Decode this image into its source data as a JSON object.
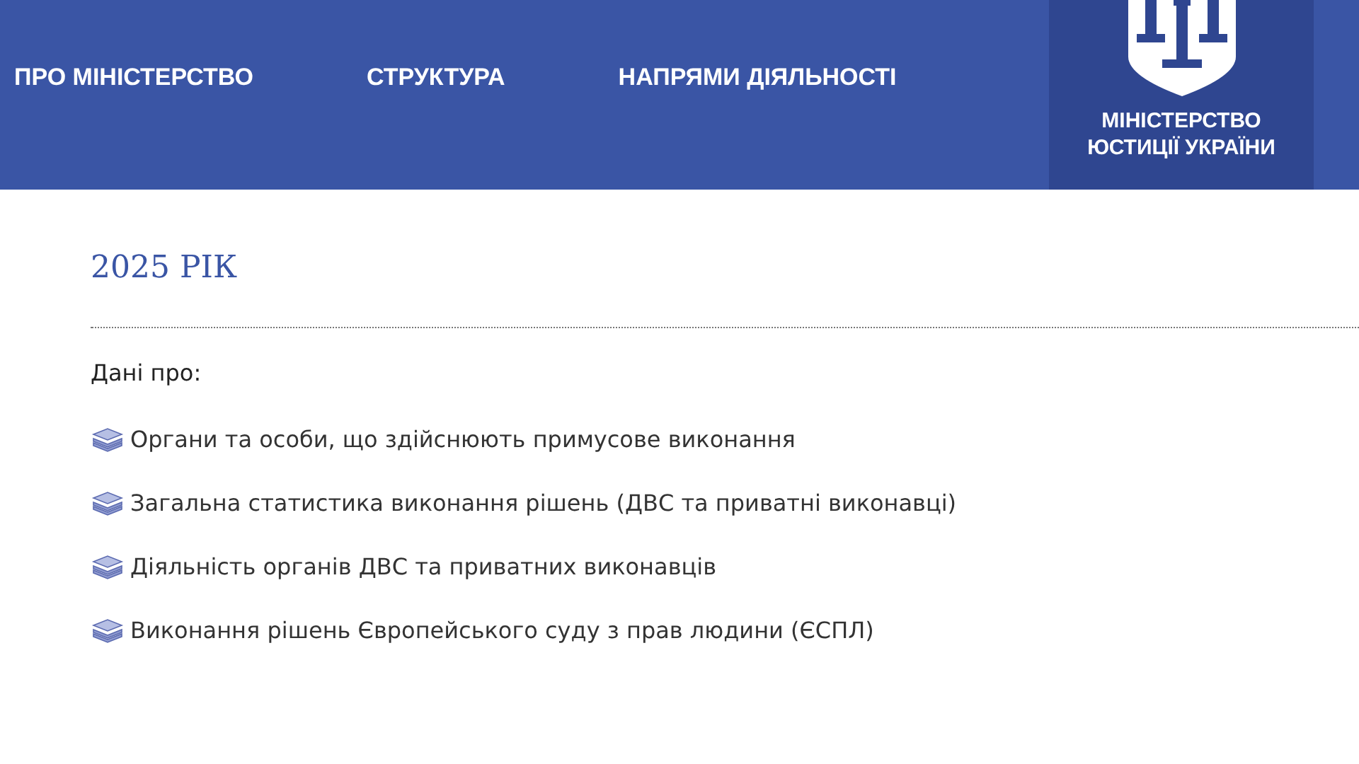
{
  "nav": [
    {
      "label": "ПРО МІНІСТЕРСТВО"
    },
    {
      "label": "СТРУКТУРА"
    },
    {
      "label": "НАПРЯМИ ДІЯЛЬНОСТІ"
    }
  ],
  "logo": {
    "lines": [
      "МІНІСТЕРСТВО",
      "ЮСТИЦІЇ УКРАЇНИ"
    ]
  },
  "heading": "2025 РІК",
  "intro": "Дані про:",
  "links": [
    {
      "label": "Органи та особи, що здійснюють примусове виконання"
    },
    {
      "label": "Загальна статистика виконання рішень (ДВС та приватні виконавці)"
    },
    {
      "label": "Діяльність органів ДВС та приватних виконавців"
    },
    {
      "label": "Виконання рішень Європейського суду з прав людини (ЄСПЛ)"
    }
  ]
}
